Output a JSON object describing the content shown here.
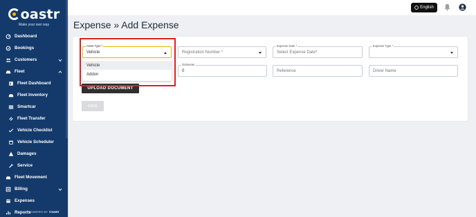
{
  "brand": {
    "name": "oastr",
    "tagline": "Make your own way"
  },
  "sidebar": {
    "items": [
      {
        "label": "Dashboard",
        "icon": "dashboard-icon",
        "sub": false,
        "chevron": ""
      },
      {
        "label": "Bookings",
        "icon": "bookings-icon",
        "sub": false,
        "chevron": ""
      },
      {
        "label": "Customers",
        "icon": "customers-icon",
        "sub": false,
        "chevron": "down"
      },
      {
        "label": "Fleet",
        "icon": "fleet-icon",
        "sub": false,
        "chevron": "up"
      },
      {
        "label": "Fleet Dashboard",
        "icon": "fleet-dashboard-icon",
        "sub": true,
        "chevron": ""
      },
      {
        "label": "Fleet Inventory",
        "icon": "fleet-inventory-icon",
        "sub": true,
        "chevron": ""
      },
      {
        "label": "Smartcar",
        "icon": "smartcar-icon",
        "sub": true,
        "chevron": ""
      },
      {
        "label": "Fleet Transfer",
        "icon": "fleet-transfer-icon",
        "sub": true,
        "chevron": ""
      },
      {
        "label": "Vehicle Checklist",
        "icon": "checklist-icon",
        "sub": true,
        "chevron": ""
      },
      {
        "label": "Vehicle Scheduler",
        "icon": "scheduler-icon",
        "sub": true,
        "chevron": ""
      },
      {
        "label": "Damages",
        "icon": "damages-icon",
        "sub": true,
        "chevron": ""
      },
      {
        "label": "Service",
        "icon": "service-icon",
        "sub": true,
        "chevron": ""
      },
      {
        "label": "Fleet Movement",
        "icon": "fleet-movement-icon",
        "sub": false,
        "chevron": ""
      },
      {
        "label": "Billing",
        "icon": "billing-icon",
        "sub": false,
        "chevron": "down"
      },
      {
        "label": "Expenses",
        "icon": "expenses-icon",
        "sub": false,
        "chevron": ""
      },
      {
        "label": "Reports",
        "icon": "reports-icon",
        "sub": false,
        "chevron": ""
      }
    ],
    "powered_by": "POWERED BY",
    "powered_brand": "Coastr"
  },
  "topbar": {
    "language": "English"
  },
  "page": {
    "title": "Expense » Add Expense"
  },
  "form": {
    "asset_type": {
      "label": "Asset Type *",
      "value": "Vehicle"
    },
    "registration_number": {
      "placeholder": "Registration Number *"
    },
    "expense_date": {
      "label": "Expense Date *",
      "placeholder": "Select Expense Date*"
    },
    "expense_type": {
      "label": "Expense Type *",
      "value": ""
    },
    "odometer": {
      "label": "Odometer",
      "value": "0"
    },
    "reference": {
      "placeholder": "Reference"
    },
    "driver_name": {
      "placeholder": "Driver Name"
    },
    "dropdown_options": [
      "Vehicle",
      "Addon"
    ],
    "upload_label": "UPLOAD DOCUMENT",
    "save_label": "SAVE"
  },
  "colors": {
    "sidebar_bg": "#143a6b",
    "highlight": "#e01e1e",
    "active_border": "#e4b400"
  }
}
